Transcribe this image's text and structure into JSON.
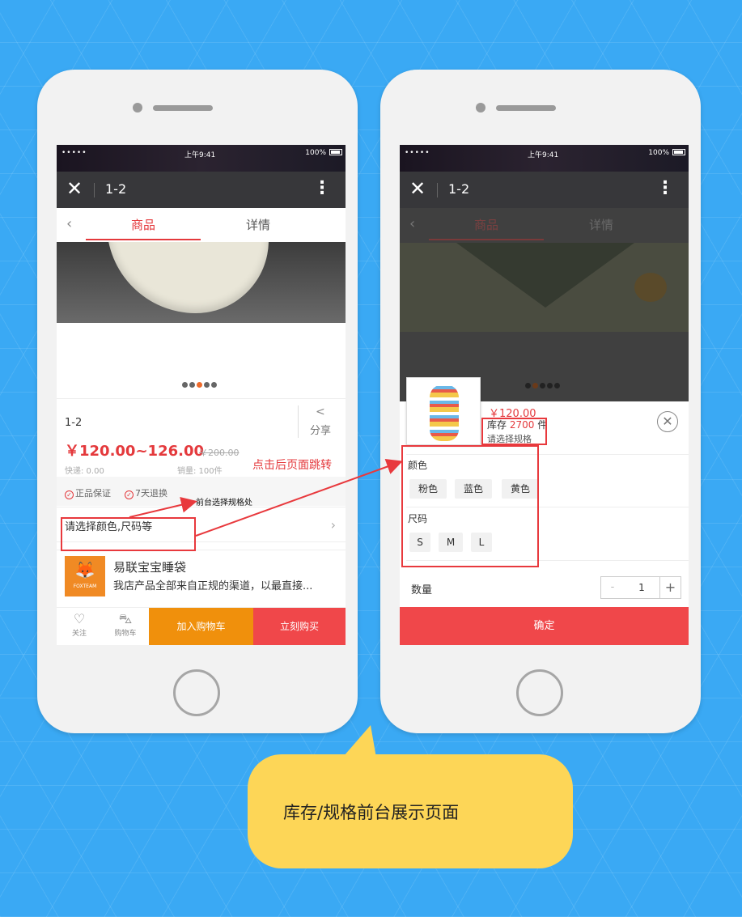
{
  "status_bar": {
    "signal": "•••••",
    "time": "上午9:41",
    "battery": "100%"
  },
  "left_phone": {
    "title_bar": {
      "close_glyph": "✕",
      "title": "1-2",
      "more_glyph": "⋮"
    },
    "tabs": {
      "back_glyph": "‹",
      "goods": "商品",
      "details": "详情"
    },
    "product": {
      "name": "1-2",
      "price": "￥120.00~126.00",
      "original_price": "￥200.00",
      "shipping": "快递: 0.00",
      "sales": "销量: 100件",
      "share_label": "分享"
    },
    "guarantees": {
      "genuine": "正品保证",
      "return": "7天退换",
      "mark": "✓"
    },
    "spec_prompt": "请选择颜色,尺码等",
    "shop": {
      "logo_text": "FOXTEAM",
      "name": "易联宝宝睡袋",
      "description": "我店产品全部来自正规的渠道，以最直接..."
    },
    "bottom_bar": {
      "follow": "关注",
      "cart": "购物车",
      "add_to_cart": "加入购物车",
      "buy_now": "立刻购买"
    }
  },
  "right_phone": {
    "title_bar": {
      "close_glyph": "✕",
      "title": "1-2",
      "more_glyph": "⋮"
    },
    "tabs": {
      "back_glyph": "‹",
      "goods": "商品",
      "details": "详情"
    },
    "sheet": {
      "price": "￥120.00",
      "stock_prefix": "库存",
      "stock_count": "2700",
      "stock_suffix": "件",
      "select_hint": "请选择规格",
      "close_glyph": "✕",
      "color_label": "颜色",
      "colors": [
        "粉色",
        "蓝色",
        "黄色"
      ],
      "size_label": "尺码",
      "sizes": [
        "S",
        "M",
        "L"
      ],
      "quantity_label": "数量",
      "quantity_value": "1",
      "minus": "-",
      "plus": "+",
      "confirm": "确定"
    }
  },
  "annotations": {
    "jump_note": "点击后页面跳转",
    "spec_location": "前台选择规格处",
    "caption": "库存/规格前台展示页面"
  },
  "colors": {
    "background": "#3aa9f4",
    "accent_red": "#e4393c",
    "cart_orange": "#f0900c",
    "bubble_yellow": "#fdd657"
  }
}
